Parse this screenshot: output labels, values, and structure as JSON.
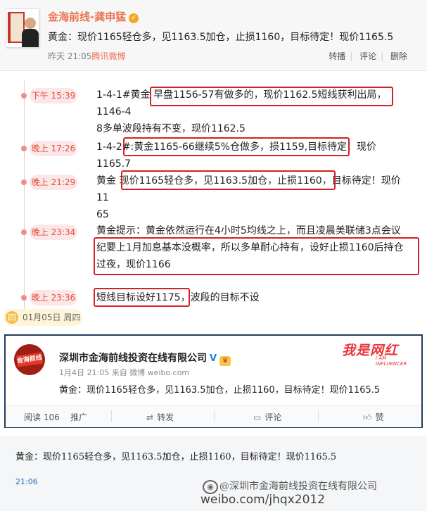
{
  "top_post": {
    "author": "金海前线-龚申猛",
    "verified_icon": "verified-badge-icon",
    "text": "黄金：现价1165轻仓多，见1163.5加仓，止损1160，目标待定！现价1165.5",
    "time": "昨天 21:05",
    "source": "腾讯微博",
    "actions": [
      "转播",
      "评论",
      "删除"
    ]
  },
  "timeline": {
    "entries": [
      {
        "time": "下午 15:39",
        "line1": "1-4-1#黄金  早盘1156-57有做多的，现价1162.5短线获利出局，1146-4",
        "line2": "8多单波段持有不变，现价1162.5"
      },
      {
        "time": "晚上 17:26",
        "line1": "1-4-2#:黄金1165-66继续5%仓做多，损1159,目标待定！现价1165.7",
        "line2": ""
      },
      {
        "time": "晚上 21:29",
        "line1": "黄金  现价1165轻仓多，见1163.5加仓，止损1160，目标待定！现价11",
        "line2": "65"
      },
      {
        "time": "晚上 23:34",
        "line1": "黄金提示：黄金依然运行在4小时5均线之上，而且凌晨美联储3点会议",
        "line2": "纪要上1月加息基本没概率，所以多单耐心持有，设好止损1160后持仓",
        "line3": "过夜，现价1166"
      },
      {
        "time": "晚上 23:36",
        "line1": "短线目标设好1175，波段的目标不设",
        "line2": ""
      }
    ],
    "date_badge_num": "四",
    "date_label": "01月05日 周四"
  },
  "card": {
    "author": "深圳市金海前线投资在线有限公司",
    "verified": "V",
    "meta": "1月4日 21:05 来自 微博 weibo.com",
    "text": "黄金：现价1165轻仓多，见1163.5加仓，止损1160，目标待定！现价1165.5",
    "watermark_title": "我是网红",
    "watermark_sub": "I AM INFLUENCER",
    "avatar_text": "金海前线",
    "actions": {
      "read": "阅读 106",
      "promote": "推广",
      "repost": "转发",
      "comment": "评论",
      "like": "赞"
    }
  },
  "bottom_post": {
    "text": "黄金：现价1165轻仓多，见1163.5加仓，止损1160，目标待定！现价1165.5",
    "time": "21:06",
    "watermark_line1": "@深圳市金海前线投资在线有限公司",
    "watermark_line2": "weibo.com/jhqx2012"
  },
  "colors": {
    "accent": "#eb7350",
    "highlight_box": "#d52024",
    "badge_bg": "#fbe7e7",
    "badge_text": "#e74c3c",
    "card_border": "#1f3e5c",
    "link_blue": "#2a6bb2"
  }
}
